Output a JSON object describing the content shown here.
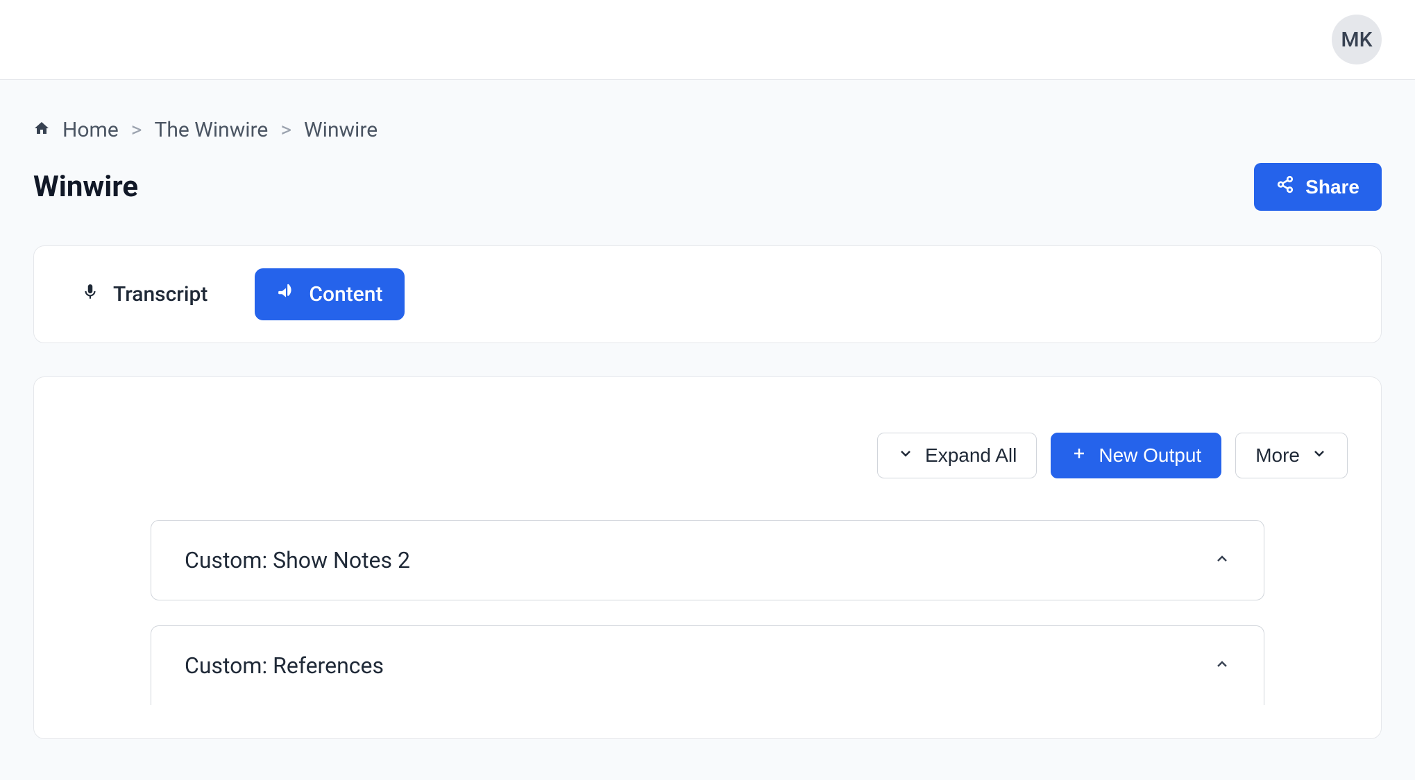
{
  "header": {
    "avatar_initials": "MK"
  },
  "breadcrumb": {
    "items": [
      {
        "label": "Home"
      },
      {
        "label": "The Winwire"
      },
      {
        "label": "Winwire"
      }
    ]
  },
  "page": {
    "title": "Winwire",
    "share_label": "Share"
  },
  "tabs": [
    {
      "label": "Transcript",
      "active": false
    },
    {
      "label": "Content",
      "active": true
    }
  ],
  "toolbar": {
    "expand_all_label": "Expand All",
    "new_output_label": "New Output",
    "more_label": "More"
  },
  "accordion": [
    {
      "title": "Custom: Show Notes 2"
    },
    {
      "title": "Custom: References"
    }
  ]
}
